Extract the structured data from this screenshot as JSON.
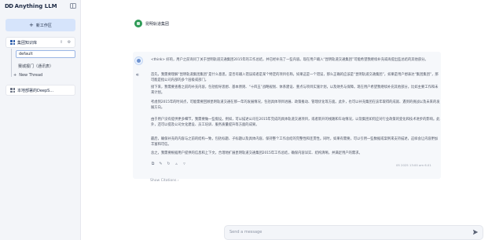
{
  "app": {
    "logo": "DD",
    "name": "Anything LLM"
  },
  "sidebar": {
    "new_workspace_label": "新工作区",
    "workspaces": [
      {
        "label": "集团知识库"
      },
      {
        "label": "本地部署的DeepS..."
      }
    ],
    "threads": [
      {
        "label": "default"
      },
      {
        "label": "赛城报门（通讯表）"
      }
    ],
    "new_thread_label": "New Thread"
  },
  "chat": {
    "header_title": "昆明轨道集团",
    "message": {
      "p1": "<think> 好的，用户之前询问了关于昆明轨道交通集团2015年的工作总结，并已经补充了一些内容。现在用户输入“昆明轨道交通集团”可能希望我继续补充或再提出些总结的其他部分。",
      "p2": "首先，我需要理解“昆明轨道集团集团”是什么意思，是否有输入错误或者是某个特定的项目名称。如果这是一个错误，那么正确的应该是“昆明轨道交通集团”，如果是用户想表达“集团集团”，那可能是指公司内部的多个层级或部门。",
      "p3": "接下来，我需要查看之前的补充内容，包括指导思想、基本原则、“十四五”战略规划、体系建设、重点与项目实施计划，以及财务与保障。现在用户希望我继续补充其他部分，比如主要工作和未来计划。",
      "p4": "考虑到2015年的时间点，可能需要回顾昆明轨道交通在那一年的发展情况，包括具体项目进展、政策推动、管理优化等方面。此外，也可以补充集团在该年取得的成就、遇到的挑战以及未来的发展方向。",
      "p5": "由于用户没有提供更多细节，我需要做一些假设。例如，可以描述公司在2015年完成的具体轨道交通项目，或者新开的线路和车站情况，以及集团如何应对行业政策的变化和技术进步的影响。此外，还可以提及公司文化建设、员工培训、服务质量提升等方面的成果。",
      "p6": "最后，确保补充的内容与之前的结构一致，包括标题、子标题以及具体内容，保持整个工作总结的完整性和连贯性。同时，如果有需要，可以引用一些数据或案例来支持描述，这样会让内容更加丰富和可信。",
      "p7": "总之，我需要根据用户提供的信息和上下文，合理地扩展昆明轨道交通集团2015年工作总结，确保内容详实、结构清晰，并满足用户的需求。",
      "timestamp": "05 2025 13:00 am 6.01"
    },
    "show_citations_label": "Show Citations",
    "composer_placeholder": "Send a message"
  }
}
